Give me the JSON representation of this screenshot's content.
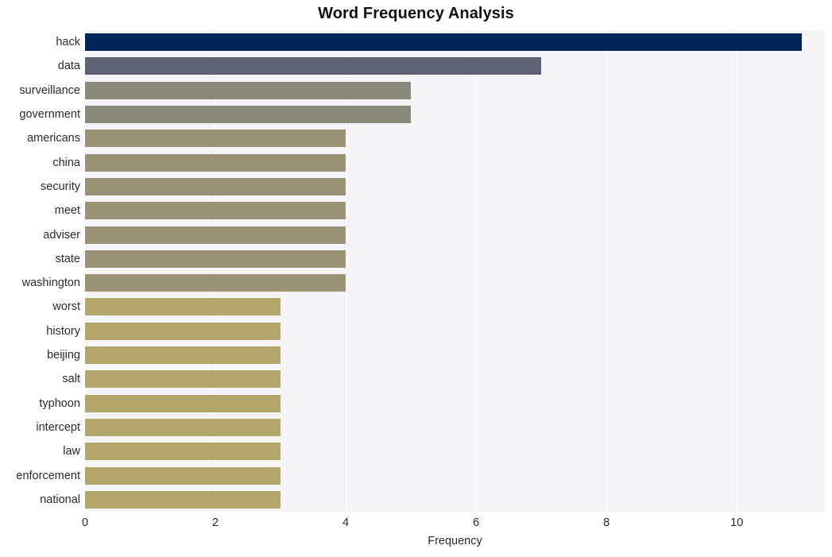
{
  "chart_data": {
    "type": "bar",
    "orientation": "horizontal",
    "title": "Word Frequency Analysis",
    "xlabel": "Frequency",
    "ylabel": "",
    "xlim": [
      0,
      11.35
    ],
    "xticks": [
      0,
      2,
      4,
      6,
      8,
      10
    ],
    "xtick_labels": [
      "0",
      "2",
      "4",
      "6",
      "8",
      "10"
    ],
    "grid": true,
    "grid_axis": "x",
    "legend": "none",
    "categories": [
      "hack",
      "data",
      "surveillance",
      "government",
      "americans",
      "china",
      "security",
      "meet",
      "adviser",
      "state",
      "washington",
      "worst",
      "history",
      "beijing",
      "salt",
      "typhoon",
      "intercept",
      "law",
      "enforcement",
      "national"
    ],
    "values": [
      11,
      7,
      5,
      5,
      4,
      4,
      4,
      4,
      4,
      4,
      4,
      3,
      3,
      3,
      3,
      3,
      3,
      3,
      3,
      3
    ],
    "bar_colors": [
      "#04255a",
      "#5e6274",
      "#8a8a7c",
      "#8a8a7c",
      "#9a9277",
      "#9a9277",
      "#9a9277",
      "#9a9277",
      "#9a9277",
      "#9a9277",
      "#9a9277",
      "#b2a66d",
      "#b2a66d",
      "#b2a66d",
      "#b2a66d",
      "#b2a66d",
      "#b2a66d",
      "#b2a66d",
      "#b2a66d",
      "#b2a66d"
    ],
    "plot_background": "#f5f5f7",
    "figure_background": "#ffffff",
    "gridline_color": "#ffffff",
    "text_color": "#2b2b2b"
  }
}
